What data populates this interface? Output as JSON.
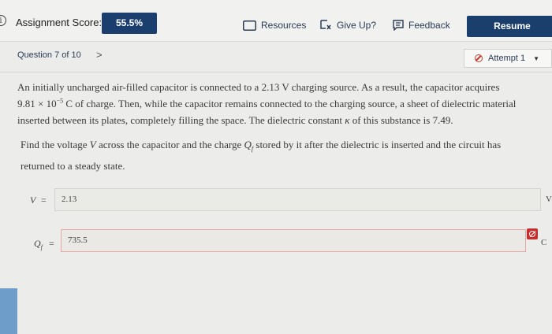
{
  "header": {
    "score_label": "Assignment Score:",
    "score_value": "55.5%",
    "resources_label": "Resources",
    "giveup_label": "Give Up?",
    "feedback_label": "Feedback",
    "resume_label": "Resume"
  },
  "nav": {
    "question_position": "Question 7 of 10",
    "next_chevron": ">",
    "attempt_label": "Attempt 1"
  },
  "question": {
    "line1": "An initially uncharged air-filled capacitor is connected to a 2.13 V charging source. As a result, the capacitor acquires",
    "line2_value": "9.81 × 10",
    "line2_exp": "−5",
    "line2_rest": " C of charge. Then, while the capacitor remains connected to the charging source, a sheet of dielectric material",
    "line3_pre": "inserted between its plates, completely filling the space. The dielectric constant ",
    "kappa": "κ",
    "line3_post": " of this substance is 7.49.",
    "prompt_pre": "Find the voltage ",
    "prompt_V": "V",
    "prompt_mid": " across the capacitor and the charge ",
    "prompt_Q": "Q",
    "prompt_Qsub": "f",
    "prompt_post": " stored by it after the dielectric is inserted and the circuit has",
    "prompt_line2": "returned to a steady state."
  },
  "answers": {
    "v_symbol": "V",
    "v_equals": "=",
    "v_value": "2.13",
    "v_unit": "V",
    "q_symbol": "Q",
    "q_sub": "f",
    "q_equals": "=",
    "q_value": "735.5",
    "q_unit": "C"
  },
  "colors": {
    "accent": "#1b3f6d",
    "error": "#c62d2d"
  }
}
